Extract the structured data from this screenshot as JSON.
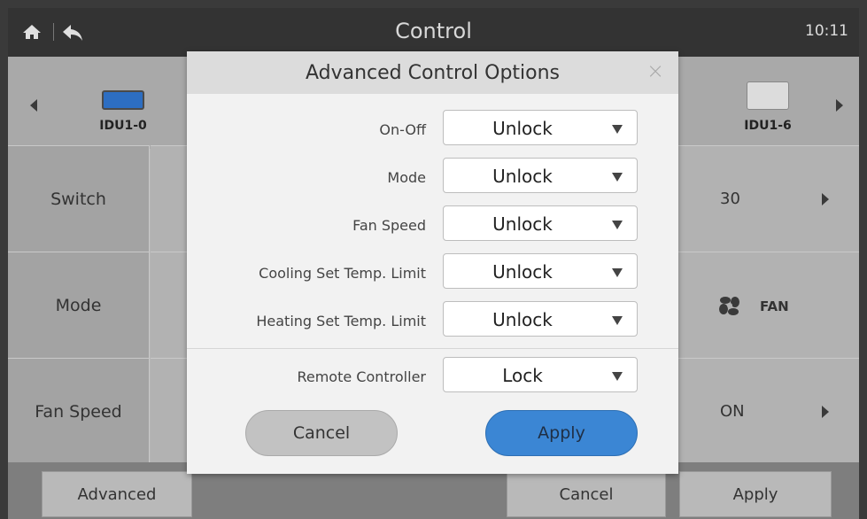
{
  "header": {
    "title": "Control",
    "clock": "10:11"
  },
  "devices": [
    {
      "name": "IDU1-0",
      "color": "#3a7fd0"
    },
    {
      "name": "IDU1-6",
      "color": "#ededed"
    }
  ],
  "rows": [
    {
      "label": "Switch",
      "right_value": "30"
    },
    {
      "label": "Mode",
      "right_value": "FAN"
    },
    {
      "label": "Fan Speed",
      "right_value": "ON"
    }
  ],
  "bottom_bar": {
    "advanced": "Advanced",
    "cancel": "Cancel",
    "apply": "Apply"
  },
  "modal": {
    "title": "Advanced Control Options",
    "options": [
      {
        "label": "On-Off",
        "value": "Unlock"
      },
      {
        "label": "Mode",
        "value": "Unlock"
      },
      {
        "label": "Fan Speed",
        "value": "Unlock"
      },
      {
        "label": "Cooling Set Temp. Limit",
        "value": "Unlock"
      },
      {
        "label": "Heating Set Temp. Limit",
        "value": "Unlock"
      },
      {
        "label": "Remote Controller",
        "value": "Lock"
      }
    ],
    "cancel_label": "Cancel",
    "apply_label": "Apply"
  },
  "colors": {
    "header_bg": "#333333",
    "apply_blue": "#3b86d4",
    "cancel_grey": "#c2c2c2"
  }
}
